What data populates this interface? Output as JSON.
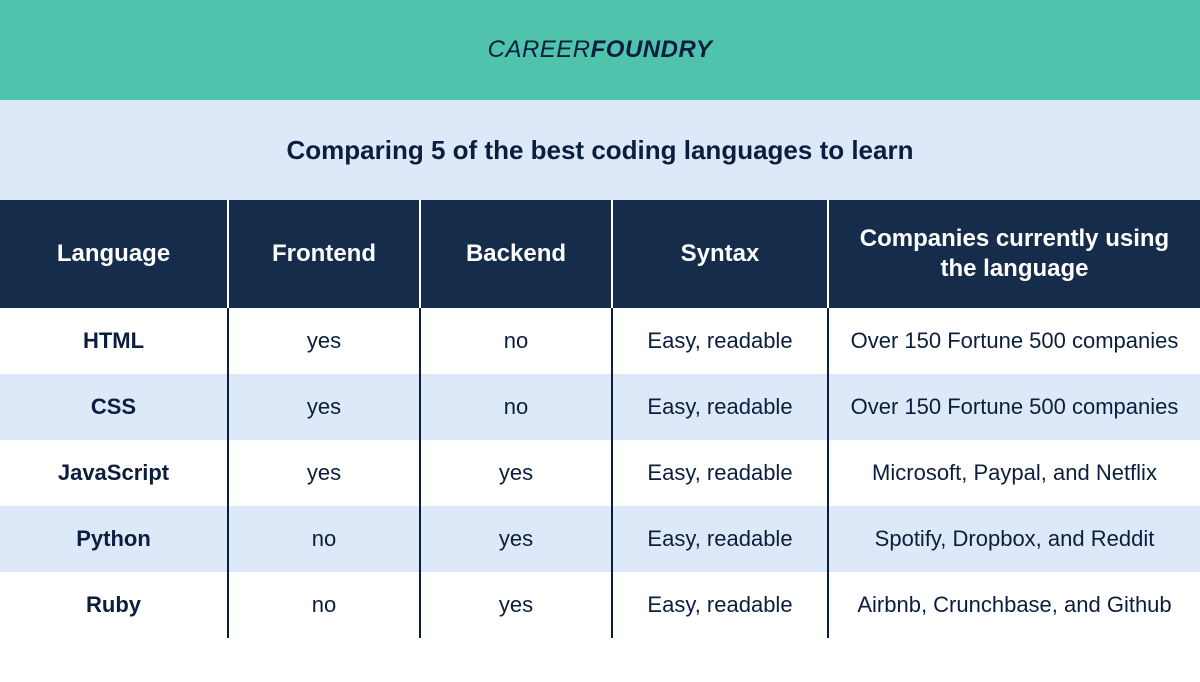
{
  "brand": {
    "part1": "CAREER",
    "part2": "FOUNDRY"
  },
  "subtitle": "Comparing 5 of the best coding languages to learn",
  "headers": {
    "language": "Language",
    "frontend": "Frontend",
    "backend": "Backend",
    "syntax": "Syntax",
    "companies": "Companies currently using the language"
  },
  "rows": [
    {
      "language": "HTML",
      "frontend": "yes",
      "backend": "no",
      "syntax": "Easy, readable",
      "companies": "Over 150 Fortune 500 companies"
    },
    {
      "language": "CSS",
      "frontend": "yes",
      "backend": "no",
      "syntax": "Easy, readable",
      "companies": "Over 150 Fortune 500 companies"
    },
    {
      "language": "JavaScript",
      "frontend": "yes",
      "backend": "yes",
      "syntax": "Easy, readable",
      "companies": "Microsoft, Paypal, and Netflix"
    },
    {
      "language": "Python",
      "frontend": "no",
      "backend": "yes",
      "syntax": "Easy, readable",
      "companies": "Spotify, Dropbox, and Reddit"
    },
    {
      "language": "Ruby",
      "frontend": "no",
      "backend": "yes",
      "syntax": "Easy, readable",
      "companies": "Airbnb, Crunchbase, and Github"
    }
  ],
  "chart_data": {
    "type": "table",
    "title": "Comparing 5 of the best coding languages to learn",
    "columns": [
      "Language",
      "Frontend",
      "Backend",
      "Syntax",
      "Companies currently using the language"
    ],
    "rows": [
      [
        "HTML",
        "yes",
        "no",
        "Easy, readable",
        "Over 150 Fortune 500 companies"
      ],
      [
        "CSS",
        "yes",
        "no",
        "Easy, readable",
        "Over 150 Fortune 500 companies"
      ],
      [
        "JavaScript",
        "yes",
        "yes",
        "Easy, readable",
        "Microsoft, Paypal, and Netflix"
      ],
      [
        "Python",
        "no",
        "yes",
        "Easy, readable",
        "Spotify, Dropbox, and Reddit"
      ],
      [
        "Ruby",
        "no",
        "yes",
        "Easy, readable",
        "Airbnb, Crunchbase, and Github"
      ]
    ]
  }
}
